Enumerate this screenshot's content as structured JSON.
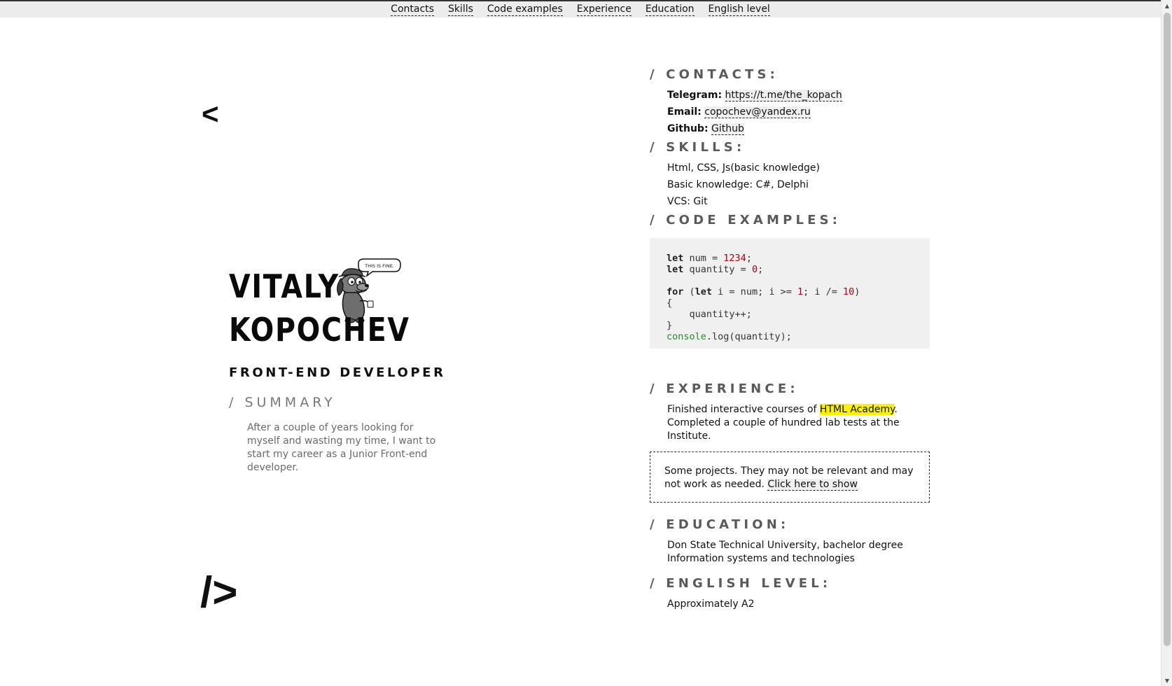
{
  "nav": {
    "items": [
      {
        "label": "Contacts"
      },
      {
        "label": "Skills"
      },
      {
        "label": "Code examples"
      },
      {
        "label": "Experience"
      },
      {
        "label": "Education"
      },
      {
        "label": "English level"
      }
    ]
  },
  "left": {
    "bracket_open": "<",
    "bracket_close": "/>",
    "name_line1": "VITALY",
    "name_line2": "KOPOCHEV",
    "dog_bubble": "THIS IS FINE.",
    "role": "FRONT-END DEVELOPER",
    "summary_heading": "/ SUMMARY",
    "summary_text": "After a couple of years looking for myself and wasting my time, I want to start my career as a Junior Front-end developer."
  },
  "contacts": {
    "heading": "/ CONTACTS:",
    "telegram_label": "Telegram:",
    "telegram_value": "https://t.me/the_kopach",
    "email_label": "Email:",
    "email_value": "copochev@yandex.ru",
    "github_label": "Github:",
    "github_value": "Github"
  },
  "skills": {
    "heading": "/ SKILLS:",
    "items": [
      "Html, CSS, Js(basic knowledge)",
      "Basic knowledge: C#, Delphi",
      "VCS: Git"
    ]
  },
  "code": {
    "heading": "/ CODE EXAMPLES:",
    "kw_let": "let",
    "kw_for": "for",
    "line1_rest": " num = ",
    "line1_num": "1234",
    "line1_end": ";",
    "line2_rest": " quantity = ",
    "line2_num": "0",
    "line2_end": ";",
    "line3_a": " (",
    "line3_b": " i = num; i >= ",
    "line3_num1": "1",
    "line3_c": "; i /= ",
    "line3_num2": "10",
    "line3_d": ")",
    "line4": "{",
    "line5": "    quantity++;",
    "line6": "}",
    "line7_fn": "console",
    "line7_rest": ".log(quantity);"
  },
  "experience": {
    "heading": "/ EXPERIENCE:",
    "text_before": "Finished interactive courses of ",
    "link": "HTML Academy",
    "text_after": ". Completed a couple of hundred lab tests at the Institute.",
    "projects_text": "Some projects. They may not be relevant and may not work as needed. ",
    "projects_link": "Click here to show"
  },
  "education": {
    "heading": "/ EDUCATION:",
    "line1": "Don State Technical University, bachelor degree",
    "line2": "Information systems and technologies"
  },
  "english": {
    "heading": "/ ENGLISH LEVEL:",
    "value": "Approximately A2"
  }
}
